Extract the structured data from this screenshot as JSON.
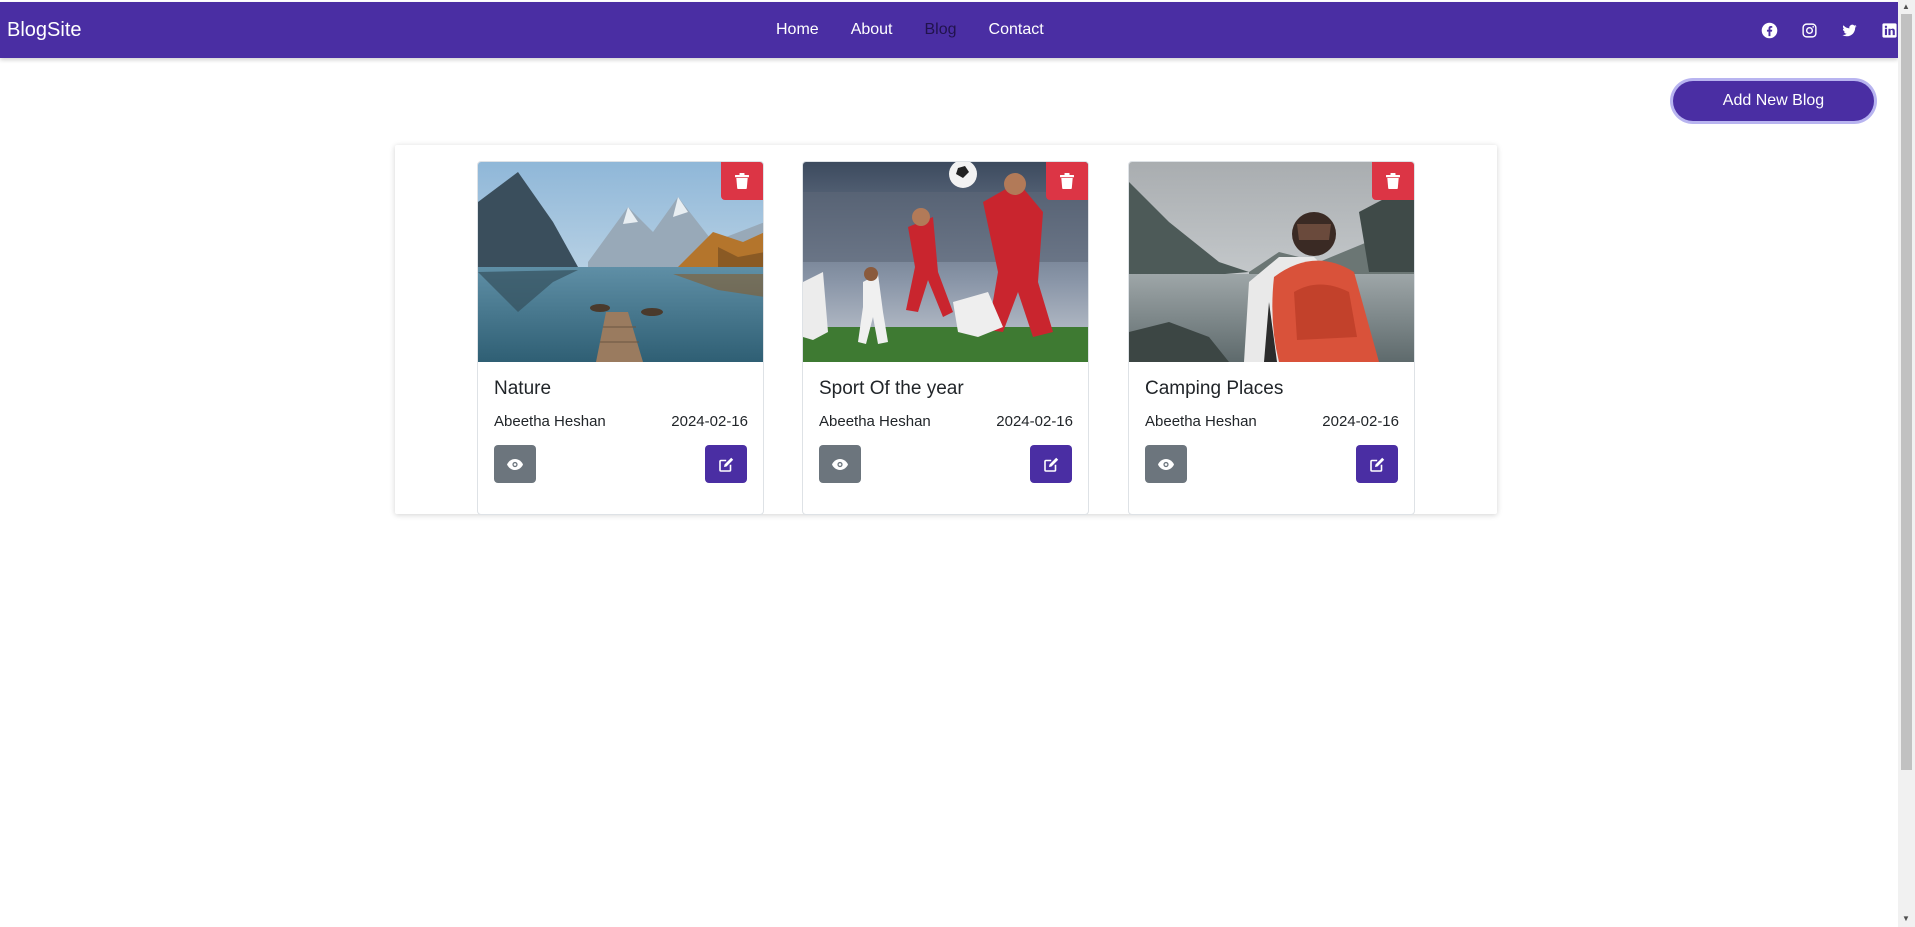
{
  "navbar": {
    "brand": "BlogSite",
    "links": [
      {
        "label": "Home"
      },
      {
        "label": "About"
      },
      {
        "label": "Blog",
        "active": true
      },
      {
        "label": "Contact"
      }
    ],
    "socials": [
      "facebook-icon",
      "instagram-icon",
      "twitter-icon",
      "linkedin-icon"
    ],
    "bg_color": "#4a2ea3"
  },
  "actions": {
    "add_label": "Add New Blog"
  },
  "blogs": [
    {
      "title": "Nature",
      "author": "Abeetha Heshan",
      "date": "2024-02-16",
      "image": "mountain lake with wooden pier and rowboats"
    },
    {
      "title": "Sport Of the year",
      "author": "Abeetha Heshan",
      "date": "2024-02-16",
      "image": "soccer players in red kits in stadium"
    },
    {
      "title": "Camping Places",
      "author": "Abeetha Heshan",
      "date": "2024-02-16",
      "image": "hiker with red backpack facing mountain lake"
    }
  ],
  "colors": {
    "danger": "#dc3545",
    "secondary": "#6c757d",
    "primary": "#4a2ea3"
  }
}
